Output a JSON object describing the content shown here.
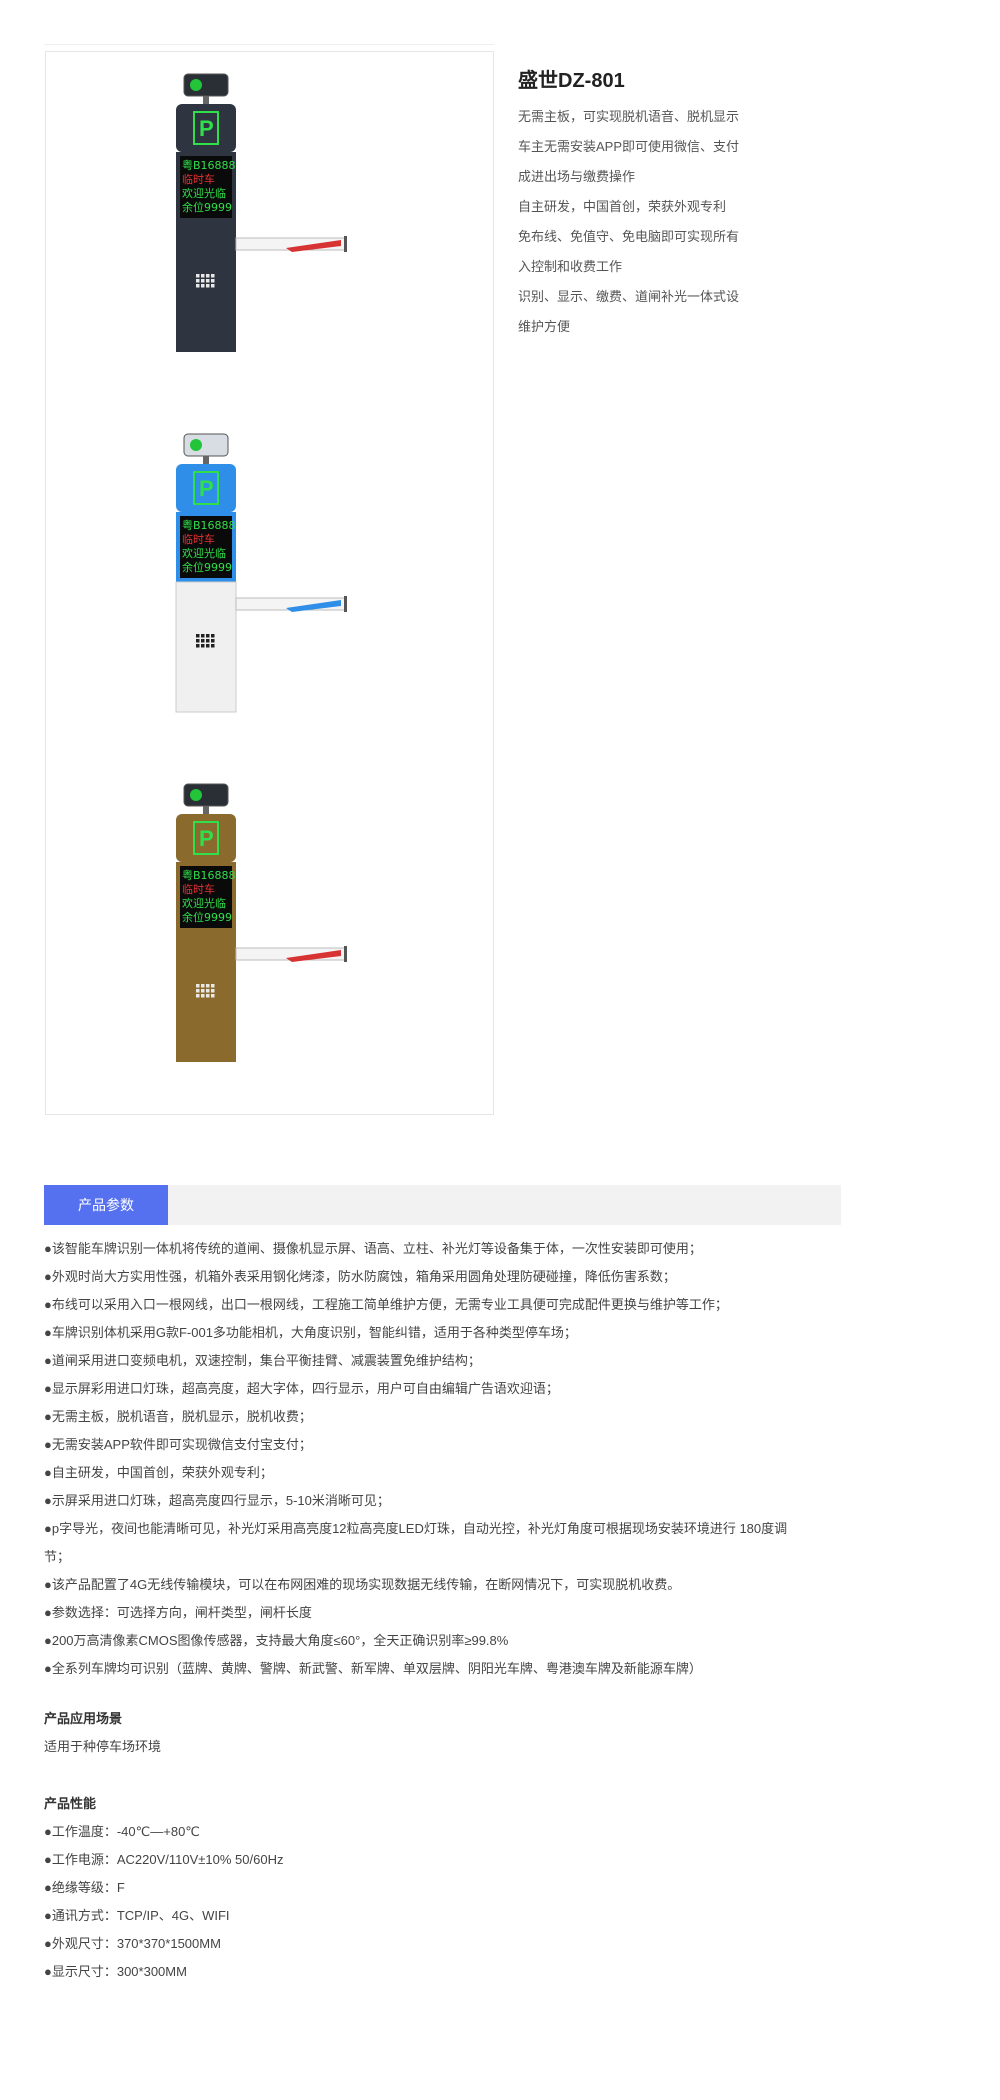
{
  "product": {
    "title": "盛世DZ-801",
    "description_lines": [
      "无需主板，可实现脱机语音、脱机显示",
      "车主无需安装APP即可使用微信、支付",
      "成进出场与缴费操作",
      "自主研发，中国首创，荣获外观专利",
      "免布线、免值守、免电脑即可实现所有",
      "入控制和收费工作",
      "识别、显示、缴费、道闸补光一体式设",
      "维护方便"
    ],
    "images": [
      {
        "variant": "dark-grey",
        "color": "#2f3540",
        "plate": "粤B16888",
        "line2": "临时车",
        "line3": "欢迎光临",
        "line4": "余位9999",
        "stripe": "#d83333"
      },
      {
        "variant": "blue-white",
        "color": "#2f8fe8",
        "plate": "粤B16888",
        "line2": "临时车",
        "line3": "欢迎光临",
        "line4": "余位9999",
        "stripe": "#2f8fe8"
      },
      {
        "variant": "bronze",
        "color": "#8b6a2d",
        "plate": "粤B16888",
        "line2": "临时车",
        "line3": "欢迎光临",
        "line4": "余位9999",
        "stripe": "#d83333"
      }
    ]
  },
  "tabs": {
    "active": "产品参数"
  },
  "params": [
    "●该智能车牌识别一体机将传统的道闸、摄像机显示屏、语高、立柱、补光灯等设备集于体，一次性安装即可使用；",
    "●外观时尚大方实用性强，机箱外表采用钢化烤漆，防水防腐蚀，箱角采用圆角处理防硬碰撞，降低伤害系数；",
    "●布线可以采用入口一根网线，出口一根网线，工程施工简单维护方便，无需专业工具便可完成配件更换与维护等工作；",
    "●车牌识别体机采用G款F-001多功能相机，大角度识别，智能纠错，适用于各种类型停车场；",
    "●道闸采用进口变频电机，双速控制，集台平衡挂臂、减震装置免维护结构；",
    "●显示屏彩用进口灯珠，超高亮度，超大字体，四行显示，用户可自由编辑广告语欢迎语；",
    "●无需主板，脱机语音，脱机显示，脱机收费；",
    "●无需安装APP软件即可实现微信支付宝支付；",
    "●自主研发，中国首创，荣获外观专利；",
    "●示屏采用进口灯珠，超高亮度四行显示，5-10米消晰可见；",
    "●p字导光，夜间也能清晰可见，补光灯采用高亮度12粒高亮度LED灯珠，自动光控，补光灯角度可根据现场安装环境进行 180度调节；",
    "●该产品配置了4G无线传输模块，可以在布网困难的现场实现数据无线传输，在断网情况下，可实现脱机收费。",
    "●参数选择：可选择方向，闸杆类型，闸杆长度",
    "●200万高清像素CMOS图像传感器，支持最大角度≤60°，全天正确识别率≥99.8%",
    "●全系列车牌均可识别（蓝牌、黄牌、警牌、新武警、新军牌、单双层牌、阴阳光车牌、粤港澳车牌及新能源车牌）"
  ],
  "scenario": {
    "title": "产品应用场景",
    "text": "适用于种停车场环境"
  },
  "performance": {
    "title": "产品性能",
    "items": [
      "●工作温度：-40℃—+80℃",
      "●工作电源：AC220V/110V±10% 50/60Hz",
      "●绝缘等级：F",
      "●通讯方式：TCP/IP、4G、WIFI",
      "●外观尺寸：370*370*1500MM",
      "●显示尺寸：300*300MM"
    ]
  }
}
